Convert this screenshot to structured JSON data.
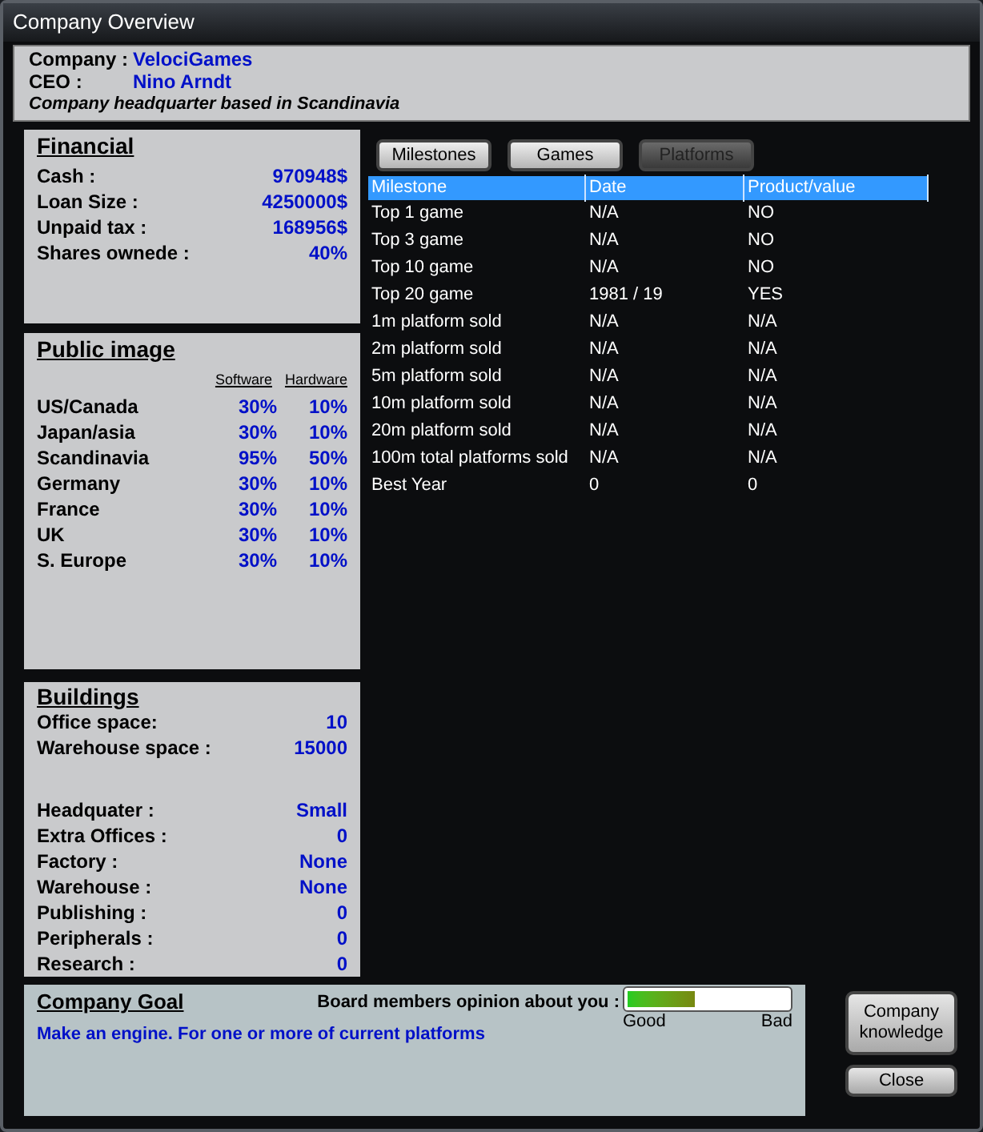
{
  "window": {
    "title": "Company Overview"
  },
  "header": {
    "company_label": "Company :",
    "company": "VelociGames",
    "ceo_label": "CEO :",
    "ceo": "Nino Arndt",
    "note": "Company headquarter based in Scandinavia"
  },
  "financial": {
    "title": "Financial",
    "rows": [
      {
        "label": "Cash :",
        "value": "970948$"
      },
      {
        "label": "Loan Size :",
        "value": "4250000$"
      },
      {
        "label": "Unpaid tax :",
        "value": "168956$"
      },
      {
        "label": "Shares ownede :",
        "value": "40%"
      }
    ]
  },
  "public_image": {
    "title": "Public image",
    "columns": [
      "Software",
      "Hardware"
    ],
    "rows": [
      {
        "region": "US/Canada",
        "software": "30%",
        "hardware": "10%"
      },
      {
        "region": "Japan/asia",
        "software": "30%",
        "hardware": "10%"
      },
      {
        "region": "Scandinavia",
        "software": "95%",
        "hardware": "50%"
      },
      {
        "region": "Germany",
        "software": "30%",
        "hardware": "10%"
      },
      {
        "region": "France",
        "software": "30%",
        "hardware": "10%"
      },
      {
        "region": "UK",
        "software": "30%",
        "hardware": "10%"
      },
      {
        "region": "S. Europe",
        "software": "30%",
        "hardware": "10%"
      }
    ]
  },
  "buildings": {
    "title": "Buildings",
    "space": [
      {
        "label": "Office space:",
        "value": "10"
      },
      {
        "label": "Warehouse space :",
        "value": "15000"
      }
    ],
    "rows": [
      {
        "label": "Headquater :",
        "value": "Small"
      },
      {
        "label": "Extra Offices :",
        "value": "0"
      },
      {
        "label": "Factory :",
        "value": "None"
      },
      {
        "label": "Warehouse :",
        "value": "None"
      },
      {
        "label": "Publishing :",
        "value": "0"
      },
      {
        "label": "Peripherals :",
        "value": "0"
      },
      {
        "label": "Research :",
        "value": "0"
      }
    ]
  },
  "tabs": [
    {
      "label": "Milestones",
      "disabled": false
    },
    {
      "label": "Games",
      "disabled": false
    },
    {
      "label": "Platforms",
      "disabled": true
    }
  ],
  "table": {
    "columns": [
      "Milestone",
      "Date",
      "Product/value"
    ],
    "rows": [
      [
        "Top 1 game",
        "N/A",
        "NO"
      ],
      [
        "Top 3 game",
        "N/A",
        "NO"
      ],
      [
        "Top 10 game",
        "N/A",
        "NO"
      ],
      [
        "Top 20 game",
        "1981 / 19",
        "YES"
      ],
      [
        "1m platform sold",
        "N/A",
        "N/A"
      ],
      [
        "2m platform sold",
        "N/A",
        "N/A"
      ],
      [
        "5m platform sold",
        "N/A",
        "N/A"
      ],
      [
        "10m platform sold",
        "N/A",
        "N/A"
      ],
      [
        "20m platform sold",
        "N/A",
        "N/A"
      ],
      [
        "100m total platforms sold",
        "N/A",
        "N/A"
      ],
      [
        "Best Year",
        "0",
        "0"
      ]
    ]
  },
  "goal": {
    "title": "Company Goal",
    "text": "Make an engine. For one or more of current platforms",
    "opinion_label": "Board members opinion about you :",
    "opinion": {
      "level": 0.42
    },
    "good_label": "Good",
    "bad_label": "Bad"
  },
  "buttons": [
    "Company knowledge",
    "Close"
  ]
}
